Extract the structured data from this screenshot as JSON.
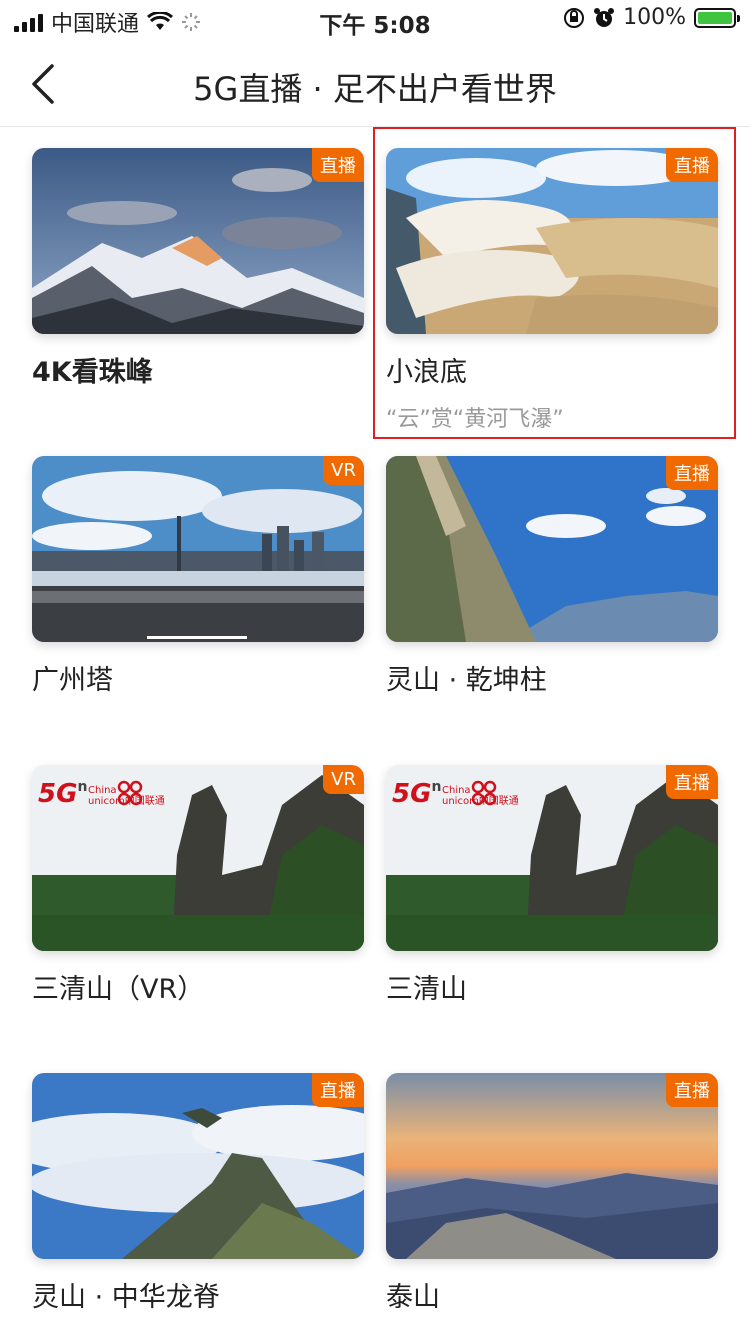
{
  "status_bar": {
    "carrier": "中国联通",
    "time": "下午 5:08",
    "battery_percent": "100%"
  },
  "nav": {
    "title": "5G直播 · 足不出户看世界"
  },
  "cards": [
    {
      "title": "4K看珠峰",
      "badge": "直播",
      "image": "mountain-everest"
    },
    {
      "title": "小浪底",
      "subtitle": "“云”赏“黄河飞瀑”",
      "badge": "直播",
      "image": "dam-waterfall"
    },
    {
      "title": "广州塔",
      "badge": "VR",
      "image": "city-skyline"
    },
    {
      "title": "灵山 · 乾坤柱",
      "badge": "直播",
      "image": "rock-cliff"
    },
    {
      "title": "三清山（VR）",
      "badge": "VR",
      "image": "sanqing-mountain",
      "logo": {
        "main": "5G",
        "sup": "n",
        "brand_top": "China",
        "brand_bottom": "unicom中国联通"
      }
    },
    {
      "title": "三清山",
      "badge": "直播",
      "image": "sanqing-mountain",
      "logo": {
        "main": "5G",
        "sup": "n",
        "brand_top": "China",
        "brand_bottom": "unicom中国联通"
      }
    },
    {
      "title": "灵山 · 中华龙脊",
      "badge": "直播",
      "image": "sea-of-clouds"
    },
    {
      "title": "泰山",
      "badge": "直播",
      "image": "sunset-peaks"
    }
  ],
  "colors": {
    "badge": "#f06a00",
    "highlight_border": "#e02020",
    "battery_fill": "#3fc43f"
  }
}
